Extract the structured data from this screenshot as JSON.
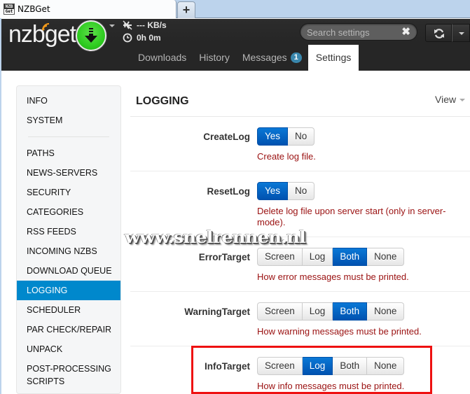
{
  "browser": {
    "tab_title": "NZBGet",
    "favicon_text_top": "NZB",
    "favicon_text_bottom": "Get",
    "new_tab_label": "+"
  },
  "header": {
    "logo_text": "nzbget",
    "speed": "--- KB/s",
    "time_left": "0h 0m",
    "search_placeholder": "Search settings",
    "search_value": "",
    "nav_tabs": [
      {
        "label": "Downloads",
        "active": false
      },
      {
        "label": "History",
        "active": false
      },
      {
        "label": "Messages",
        "active": false,
        "badge": "1"
      },
      {
        "label": "Settings",
        "active": true
      }
    ]
  },
  "sidebar": {
    "items_top": [
      "INFO",
      "SYSTEM"
    ],
    "items": [
      {
        "label": "PATHS",
        "active": false
      },
      {
        "label": "NEWS-SERVERS",
        "active": false
      },
      {
        "label": "SECURITY",
        "active": false
      },
      {
        "label": "CATEGORIES",
        "active": false
      },
      {
        "label": "RSS FEEDS",
        "active": false
      },
      {
        "label": "INCOMING NZBS",
        "active": false
      },
      {
        "label": "DOWNLOAD QUEUE",
        "active": false
      },
      {
        "label": "LOGGING",
        "active": true
      },
      {
        "label": "SCHEDULER",
        "active": false
      },
      {
        "label": "PAR CHECK/REPAIR",
        "active": false
      },
      {
        "label": "UNPACK",
        "active": false
      },
      {
        "label": "POST-PROCESSING SCRIPTS",
        "active": false
      }
    ]
  },
  "main": {
    "section_title": "LOGGING",
    "view_menu_label": "View",
    "options": [
      {
        "name": "CreateLog",
        "choices": [
          "Yes",
          "No"
        ],
        "selected": "Yes",
        "description": "Create log file."
      },
      {
        "name": "ResetLog",
        "choices": [
          "Yes",
          "No"
        ],
        "selected": "Yes",
        "description": "Delete log file upon server start (only in server-mode)."
      },
      {
        "name": "ErrorTarget",
        "choices": [
          "Screen",
          "Log",
          "Both",
          "None"
        ],
        "selected": "Both",
        "description": "How error messages must be printed."
      },
      {
        "name": "WarningTarget",
        "choices": [
          "Screen",
          "Log",
          "Both",
          "None"
        ],
        "selected": "Both",
        "description": "How warning messages must be printed."
      },
      {
        "name": "InfoTarget",
        "choices": [
          "Screen",
          "Log",
          "Both",
          "None"
        ],
        "selected": "Log",
        "description": "How info messages must be printed."
      }
    ]
  },
  "annotations": {
    "watermark": "www.snelrennen.nl",
    "highlight_color": "#ee1111"
  },
  "colors": {
    "accent_blue": "#0088cc",
    "selected_button": "#0a66c6",
    "description_text": "#9a1010",
    "play_button_green": "#2ecc20",
    "navbar_bg": "#262626"
  }
}
